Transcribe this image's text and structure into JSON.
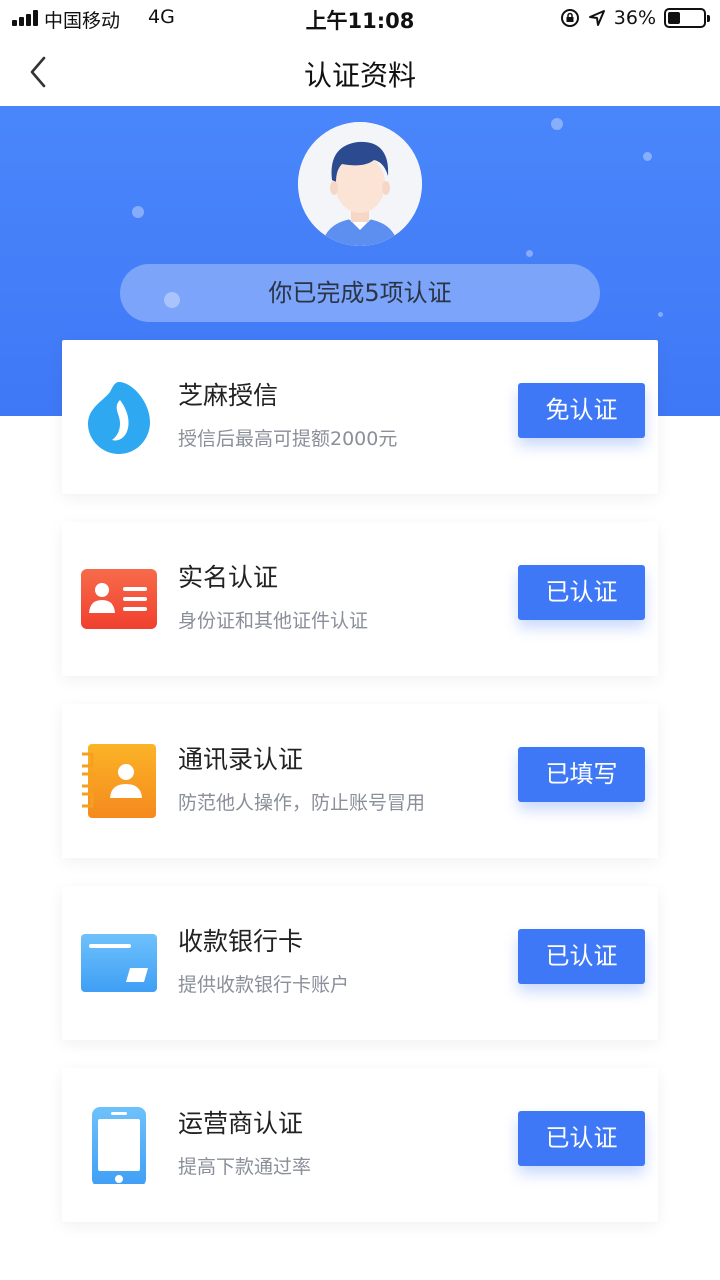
{
  "status_bar": {
    "carrier": "中国移动",
    "network": "4G",
    "time": "上午11:08",
    "battery_percent": "36%",
    "battery_level": 0.36
  },
  "nav": {
    "title": "认证资料",
    "back_icon": "chevron-left-icon"
  },
  "header": {
    "summary": "你已完成5项认证",
    "background_color": "#4a86fb"
  },
  "items": [
    {
      "title": "芝麻授信",
      "desc": "授信后最高可提额2000元",
      "action": "免认证",
      "icon": "sesame-drop-icon",
      "icon_color": "#2ea8f0"
    },
    {
      "title": "实名认证",
      "desc": "身份证和其他证件认证",
      "action": "已认证",
      "icon": "id-card-icon",
      "icon_color": "#f5533d"
    },
    {
      "title": "通讯录认证",
      "desc": "防范他人操作，防止账号冒用",
      "action": "已填写",
      "icon": "contacts-book-icon",
      "icon_color": "#f7a01f"
    },
    {
      "title": "收款银行卡",
      "desc": "提供收款银行卡账户",
      "action": "已认证",
      "icon": "bank-card-icon",
      "icon_color": "#4aa9f5"
    },
    {
      "title": "运营商认证",
      "desc": "提高下款通过率",
      "action": "已认证",
      "icon": "mobile-phone-icon",
      "icon_color": "#4aa9f5"
    }
  ],
  "accent_color": "#3f78f6"
}
